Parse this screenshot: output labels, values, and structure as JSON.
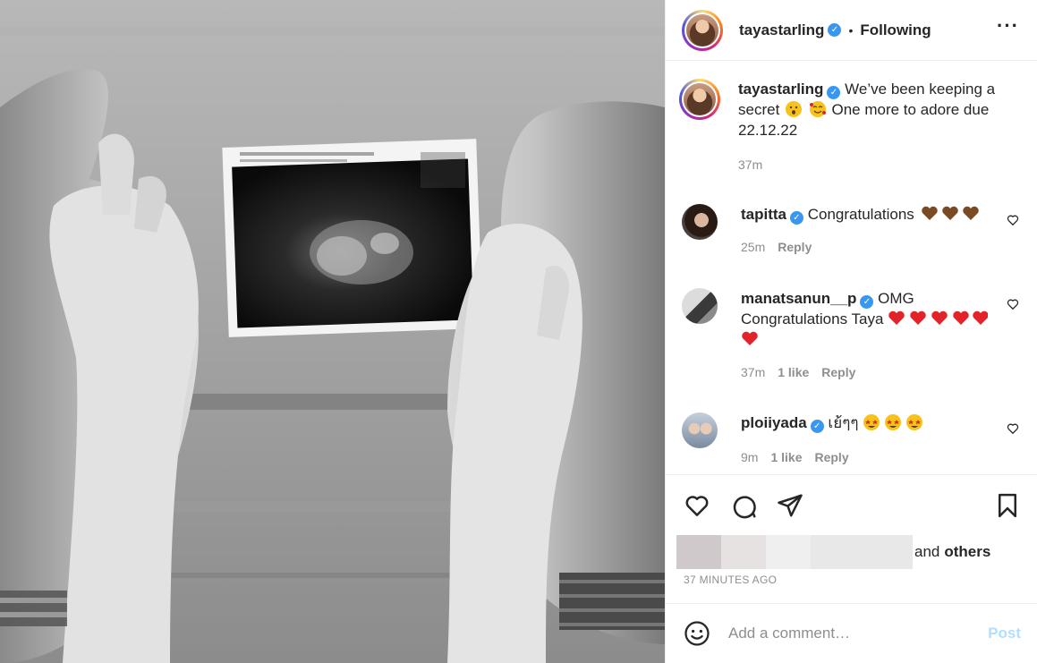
{
  "colors": {
    "accent": "#3897f0",
    "text": "#262626",
    "muted": "#8e8e8e",
    "post_disabled": "#b2dffc",
    "heart_red": "#e0242a",
    "heart_brown": "#7a4a23"
  },
  "header": {
    "username": "tayastarling",
    "verified": true,
    "separator": "•",
    "follow_status": "Following",
    "more_icon": "more-horizontal-icon"
  },
  "caption": {
    "username": "tayastarling",
    "verified": true,
    "text_part1": "We’ve been keeping a secret",
    "emoji_1": "hushed-face",
    "emoji_2": "smiling-face-with-hearts",
    "text_part2": "One more to adore due 22.12.22",
    "time": "37m"
  },
  "comments": [
    {
      "username": "tapitta",
      "verified": true,
      "text": "Congratulations",
      "emojis": [
        "brown-heart",
        "brown-heart",
        "brown-heart"
      ],
      "time": "25m",
      "likes": "",
      "reply": "Reply"
    },
    {
      "username": "manatsanun__p",
      "verified": true,
      "text": "OMG Congratulations Taya",
      "emojis": [
        "red-heart",
        "red-heart",
        "red-heart",
        "red-heart",
        "red-heart",
        "red-heart"
      ],
      "time": "37m",
      "likes": "1 like",
      "reply": "Reply"
    },
    {
      "username": "ploiiyada",
      "verified": true,
      "text": "เย้ๆๆ",
      "emojis": [
        "star-struck",
        "star-struck",
        "star-struck"
      ],
      "time": "9m",
      "likes": "1 like",
      "reply": "Reply"
    }
  ],
  "actions": {
    "like_icon": "heart-outline-icon",
    "comment_icon": "comment-bubble-icon",
    "share_icon": "paper-plane-icon",
    "save_icon": "bookmark-icon",
    "liked_by_suffix_1": "and",
    "liked_by_suffix_2": "others",
    "timestamp": "37 MINUTES AGO"
  },
  "add_comment": {
    "emoji_icon": "smiley-icon",
    "placeholder": "Add a comment…",
    "post_label": "Post"
  }
}
